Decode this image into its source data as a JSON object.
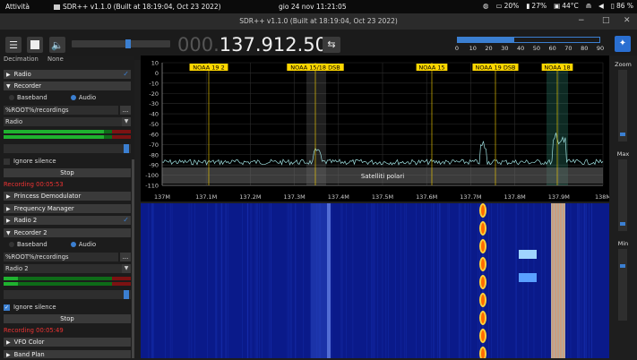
{
  "os": {
    "activities": "Attività",
    "app_name": "SDR++ v1.1.0 (Built at 18:19:04, Oct 23 2022)",
    "clock": "gio 24 nov  11:21:05",
    "tray": {
      "bat1": "20%",
      "bat2": "27%",
      "temp": "44°C",
      "bat3": "86 %"
    }
  },
  "window": {
    "title": "SDR++ v1.1.0 (Built at 18:19:04, Oct 23 2022)",
    "min": "−",
    "max": "□",
    "close": "✕"
  },
  "toolbar": {
    "freq_dim": "000.",
    "freq_bright": "137.912.500",
    "swap": "⇆",
    "snr_ticks": [
      "0",
      "10",
      "20",
      "30",
      "40",
      "50",
      "60",
      "70",
      "80",
      "90"
    ],
    "snr_level": 0.4
  },
  "left": {
    "decimation_label": "Decimation",
    "decimation_value": "None",
    "radio_header": "Radio",
    "recorder_header": "Recorder",
    "baseband": "Baseband",
    "audio": "Audio",
    "path": "%ROOT%/recordings",
    "path_btn": "...",
    "radio_select": "Radio",
    "ignore_silence": "Ignore silence",
    "stop": "Stop",
    "recording": "Recording 00:05:53",
    "princess": "Princess Demodulator",
    "freqmgr": "Frequency Manager",
    "radio2_header": "Radio 2",
    "recorder2_header": "Recorder 2",
    "baseband2": "Baseband",
    "audio2": "Audio",
    "path2": "%ROOT%/recordings",
    "path2_btn": "...",
    "radio2_select": "Radio 2",
    "ignore_silence2": "Ignore silence",
    "stop2": "Stop",
    "recording2": "Recording 00:05:49",
    "vfo_color": "VFO Color",
    "band_plan": "Band Plan"
  },
  "right": {
    "zoom": "Zoom",
    "max": "Max",
    "min": "Min"
  },
  "spectrum": {
    "y_ticks": [
      "10",
      "0",
      "-10",
      "-20",
      "-30",
      "-40",
      "-50",
      "-60",
      "-70",
      "-80",
      "-90",
      "-100",
      "-110"
    ],
    "x_ticks": [
      "137M",
      "137.1M",
      "137.2M",
      "137.3M",
      "137.4M",
      "137.5M",
      "137.6M",
      "137.7M",
      "137.8M",
      "137.9M",
      "138M"
    ],
    "bookmarks": [
      "NOAA 19 2",
      "NOAA 15/18 DSB",
      "NOAA 15",
      "NOAA 19 DSB",
      "NOAA 18"
    ],
    "band_label": "Satelliti polari"
  },
  "colors": {
    "accent": "#3b7fd1",
    "bookmark": "#ffd700",
    "trace": "#9fe0e0"
  }
}
